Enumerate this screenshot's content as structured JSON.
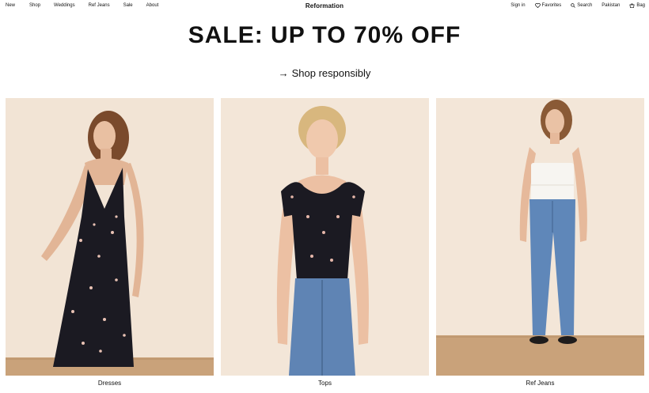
{
  "nav": {
    "left": [
      "New",
      "Shop",
      "Weddings",
      "Ref Jeans",
      "Sale",
      "About"
    ],
    "brand": "Reformation",
    "right": {
      "sign_in": "Sign in",
      "favorites": "Favorites",
      "search": "Search",
      "country": "Pakistan",
      "bag": "Bag"
    },
    "icons": {
      "favorites": "heart-icon",
      "search": "search-icon",
      "bag": "bag-icon"
    }
  },
  "hero": {
    "title": "SALE: UP TO 70% OFF",
    "shop_link": "Shop responsibly",
    "arrow": "→"
  },
  "tiles": [
    {
      "caption": "Dresses"
    },
    {
      "caption": "Tops"
    },
    {
      "caption": "Ref Jeans"
    }
  ],
  "colors": {
    "background": "#ffffff",
    "text": "#111111",
    "photo_backdrop": "#f1e4d6",
    "floor": "#c9a27a"
  }
}
